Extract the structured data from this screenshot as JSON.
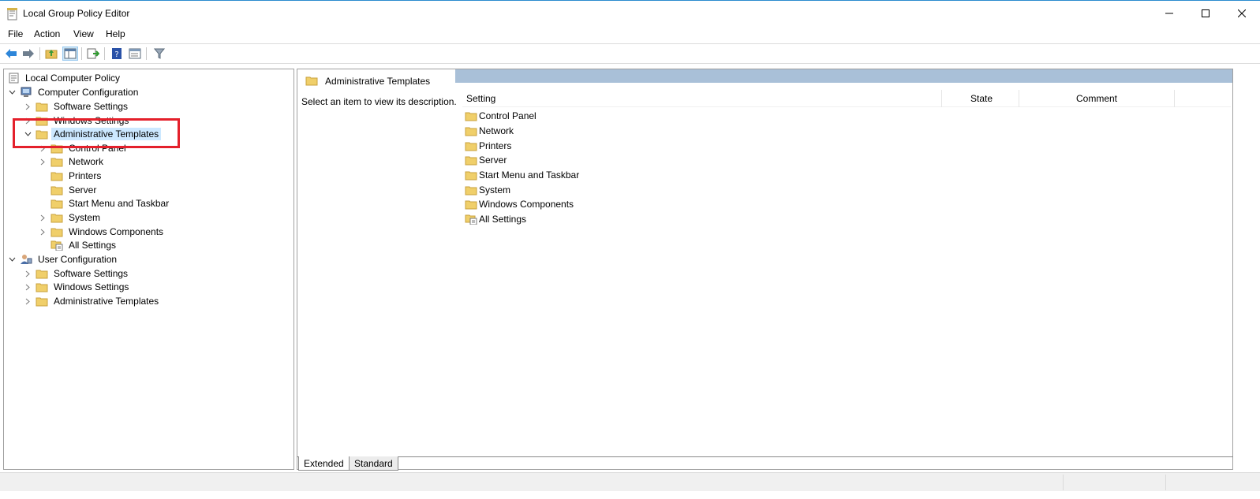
{
  "window": {
    "title": "Local Group Policy Editor"
  },
  "menu": {
    "items": [
      "File",
      "Action",
      "View",
      "Help"
    ]
  },
  "toolbar": {
    "icons": [
      "back-arrow-icon",
      "forward-arrow-icon",
      "up-folder-icon",
      "show-hide-tree-icon",
      "export-list-icon",
      "help-icon",
      "properties-icon",
      "filter-icon"
    ]
  },
  "tree": {
    "root": "Local Computer Policy",
    "computer_config": "Computer Configuration",
    "cc_software": "Software Settings",
    "cc_windows": "Windows Settings",
    "cc_admin": "Administrative Templates",
    "admin_children": {
      "control_panel": "Control Panel",
      "network": "Network",
      "printers": "Printers",
      "server": "Server",
      "start_menu": "Start Menu and Taskbar",
      "system": "System",
      "windows_components": "Windows Components",
      "all_settings": "All Settings"
    },
    "user_config": "User Configuration",
    "uc_software": "Software Settings",
    "uc_windows": "Windows Settings",
    "uc_admin": "Administrative Templates"
  },
  "right": {
    "header_title": "Administrative Templates",
    "description": "Select an item to view its description.",
    "columns": {
      "setting": "Setting",
      "state": "State",
      "comment": "Comment"
    },
    "items": {
      "control_panel": "Control Panel",
      "network": "Network",
      "printers": "Printers",
      "server": "Server",
      "start_menu": "Start Menu and Taskbar",
      "system": "System",
      "windows_components": "Windows Components",
      "all_settings": "All Settings"
    }
  },
  "tabs": {
    "extended": "Extended",
    "standard": "Standard"
  },
  "colors": {
    "selection": "#cce8ff",
    "highlight_box": "#e4202b",
    "folder": "#e8c15a",
    "header_band": "#a9c0d8"
  }
}
